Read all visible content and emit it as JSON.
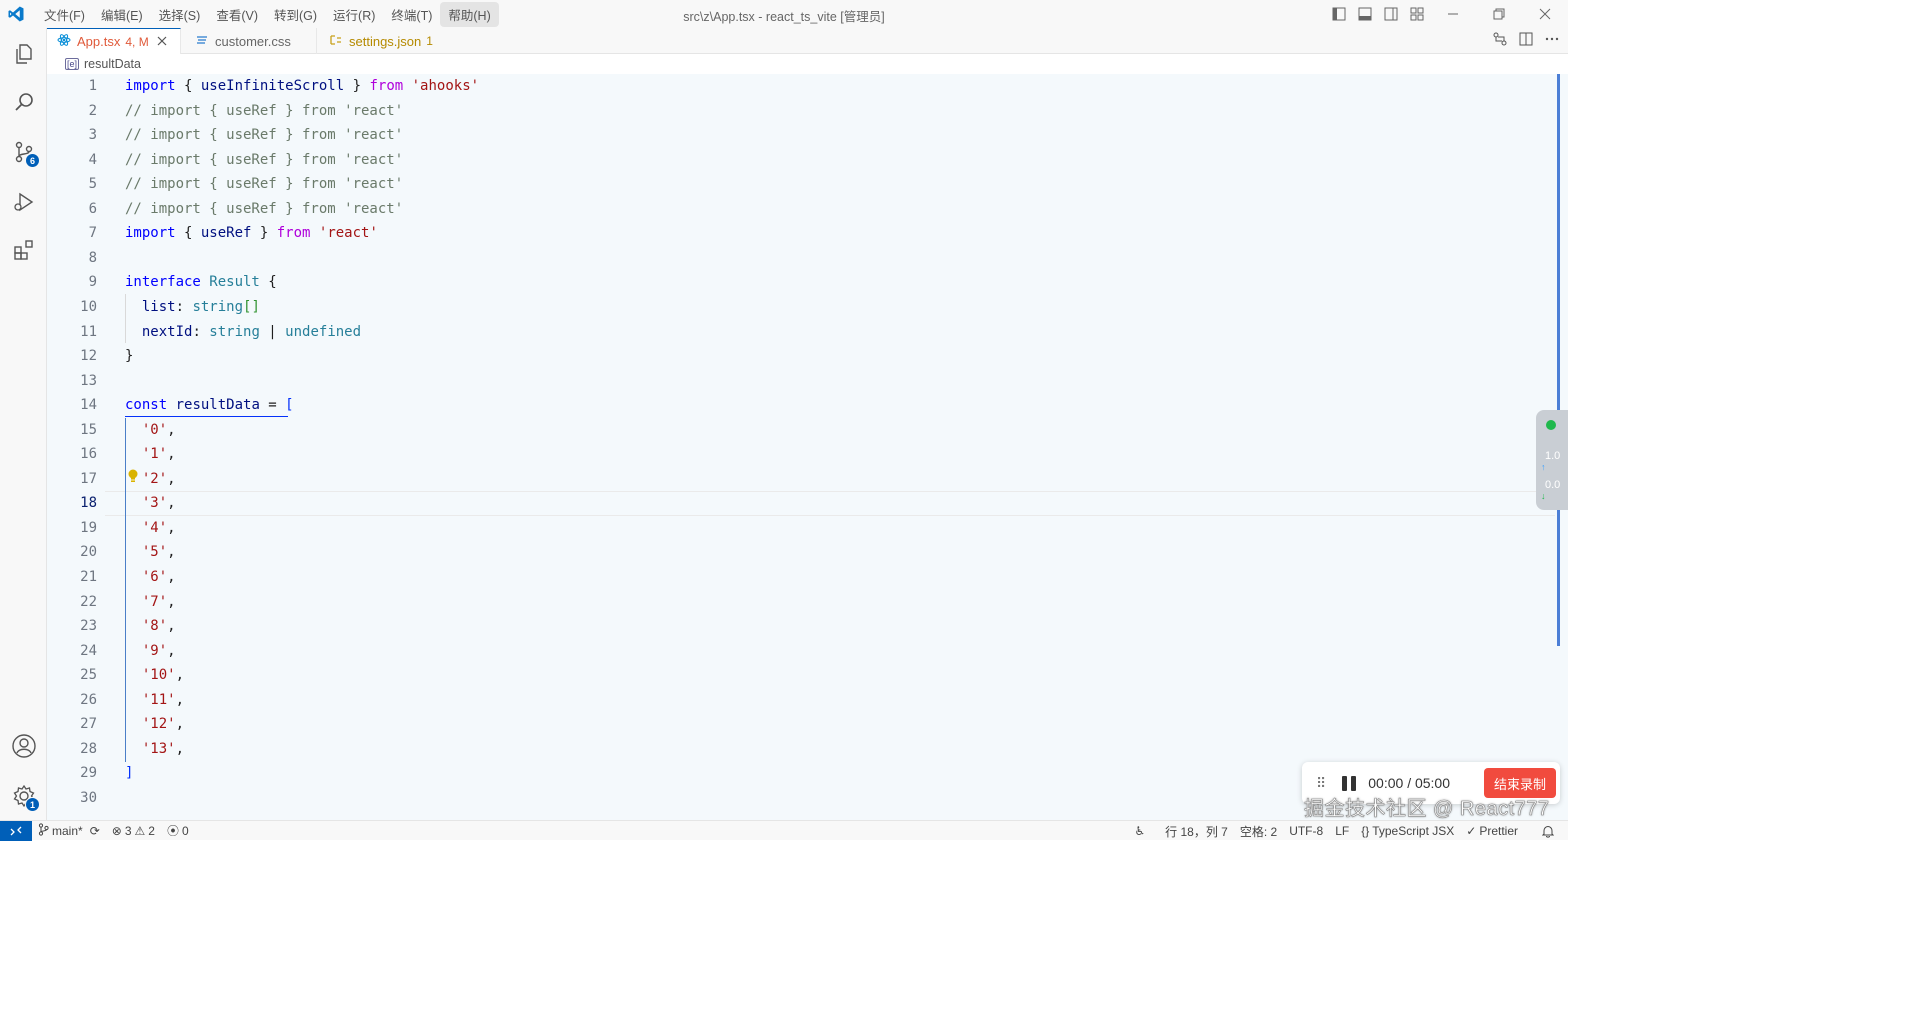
{
  "titlebar": {
    "title": "src\\z\\App.tsx - react_ts_vite [管理员]",
    "menus": [
      "文件(F)",
      "编辑(E)",
      "选择(S)",
      "查看(V)",
      "转到(G)",
      "运行(R)",
      "终端(T)",
      "帮助(H)"
    ]
  },
  "activitybar": {
    "source_control_badge": "6",
    "settings_badge": "1"
  },
  "tabs": [
    {
      "name": "App.tsx",
      "status": "4, M",
      "icon": "react-icon",
      "color": "#e05a3a"
    },
    {
      "name": "customer.css",
      "status": "",
      "icon": "css-icon",
      "color": "#3b3b3b"
    },
    {
      "name": "settings.json",
      "status": "1",
      "icon": "json-icon",
      "color": "#b58a00"
    }
  ],
  "breadcrumb": {
    "symbol": "resultData"
  },
  "editor": {
    "current_line": 18,
    "line_numbers": [
      "1",
      "2",
      "3",
      "4",
      "5",
      "6",
      "7",
      "8",
      "9",
      "10",
      "11",
      "12",
      "13",
      "14",
      "15",
      "16",
      "17",
      "18",
      "19",
      "20",
      "21",
      "22",
      "23",
      "24",
      "25",
      "26",
      "27",
      "28",
      "29",
      "30"
    ],
    "lines": [
      {
        "kw": "import",
        "a": " { ",
        "fn": "useInfiniteScroll",
        "b": " } ",
        "kw2": "from",
        "str": " 'ahooks'"
      },
      {
        "com": "// import { useRef } from 'react'"
      },
      {
        "com": "// import { useRef } from 'react'"
      },
      {
        "com": "// import { useRef } from 'react'"
      },
      {
        "com": "// import { useRef } from 'react'"
      },
      {
        "com": "// import { useRef } from 'react'"
      },
      {
        "kw": "import",
        "a": " { ",
        "fn": "useRef",
        "b": " } ",
        "kw2": "from",
        "str": " 'react'"
      },
      {},
      {
        "kw": "interface",
        "ty": " Result",
        "a": " {"
      },
      {
        "fn": "  list",
        "a": ": ",
        "ty": "string",
        "brk": "[]"
      },
      {
        "fn": "  nextId",
        "a": ": ",
        "ty": "string",
        "b": " | ",
        "ty2": "undefined"
      },
      {
        "a": "}"
      },
      {},
      {
        "kw": "const",
        "fn": " resultData",
        "a": " = ",
        "brk": "["
      },
      {
        "str": "  '0'",
        "a": ","
      },
      {
        "str": "  '1'",
        "a": ","
      },
      {
        "str": "  '2'",
        "a": ","
      },
      {
        "str": "  '3'",
        "a": ","
      },
      {
        "str": "  '4'",
        "a": ","
      },
      {
        "str": "  '5'",
        "a": ","
      },
      {
        "str": "  '6'",
        "a": ","
      },
      {
        "str": "  '7'",
        "a": ","
      },
      {
        "str": "  '8'",
        "a": ","
      },
      {
        "str": "  '9'",
        "a": ","
      },
      {
        "str": "  '10'",
        "a": ","
      },
      {
        "str": "  '11'",
        "a": ","
      },
      {
        "str": "  '12'",
        "a": ","
      },
      {
        "str": "  '13'",
        "a": ","
      },
      {
        "brk": "]"
      },
      {}
    ]
  },
  "netspeed": {
    "up": "1.0",
    "down": "0.0"
  },
  "recorder": {
    "time": "00:00 / 05:00",
    "stop_label": "结束录制"
  },
  "watermark": "掘金技术社区 @ React777",
  "statusbar": {
    "branch": "main*",
    "errors": "3",
    "warnings": "2",
    "ports": "0",
    "position": "行 18，列 7",
    "spaces": "空格: 2",
    "encoding": "UTF-8",
    "eol": "LF",
    "language": "TypeScript JSX",
    "formatter": "Prettier"
  }
}
